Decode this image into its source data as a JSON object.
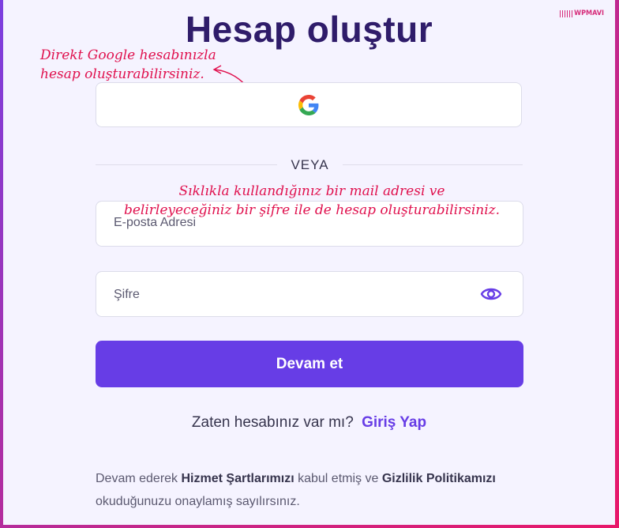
{
  "title": "Hesap oluştur",
  "brand": "WPMAVI",
  "annotations": {
    "google_line1": "Direkt Google hesabınızla",
    "google_line2": "hesap oluşturabilirsiniz.",
    "email_line1": "Sıklıkla kullandığınız bir mail adresi ve",
    "email_line2": "belirleyeceğiniz bir şifre ile de hesap oluşturabilirsiniz."
  },
  "google_button": {
    "icon": "google-icon"
  },
  "divider": "VEYA",
  "email_field": {
    "placeholder": "E-posta Adresi",
    "value": ""
  },
  "password_field": {
    "placeholder": "Şifre",
    "value": "",
    "toggle_icon": "eye-icon"
  },
  "submit_label": "Devam et",
  "login_prompt": {
    "text": "Zaten hesabınız var mı?",
    "link": "Giriş Yap"
  },
  "terms": {
    "part1": "Devam ederek",
    "link1": "Hizmet Şartlarımızı",
    "part2": "kabul etmiş ve",
    "link2": "Gizlilik Politikamızı",
    "part3": "okuduğunuzu onaylamış sayılırsınız."
  },
  "colors": {
    "primary": "#673de6",
    "title": "#2f1c6a",
    "annotation": "#e0114e",
    "background": "#f5f3ff"
  }
}
